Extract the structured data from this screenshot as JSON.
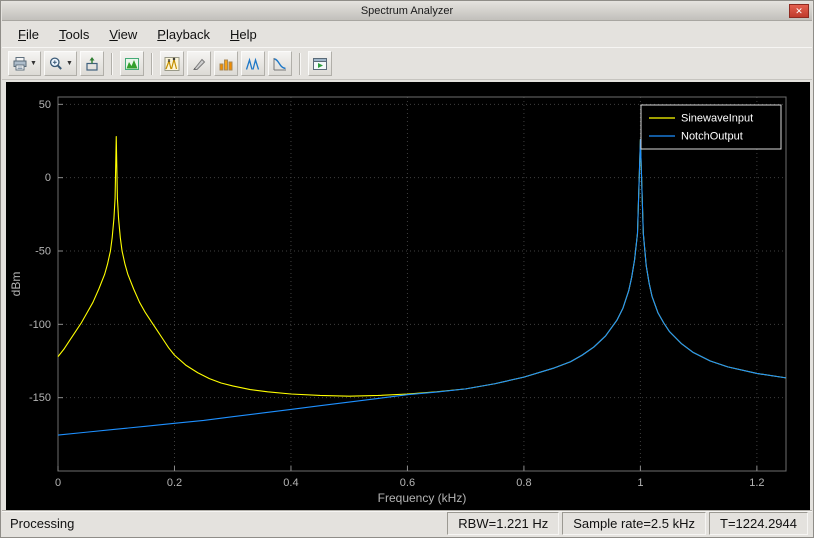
{
  "window": {
    "title": "Spectrum Analyzer"
  },
  "icons": {
    "close": "✕",
    "caret": "▼",
    "toolbar": [
      "printer-icon",
      "zoom-in-icon",
      "scale-axes-icon",
      "spectrum-settings-icon",
      "peak-finder-icon",
      "cursor-measurements-icon",
      "signal-statistics-icon",
      "spectral-mask-icon",
      "ccdf-icon",
      "playback-options-icon"
    ]
  },
  "menubar": {
    "items": [
      "File",
      "Tools",
      "View",
      "Playback",
      "Help"
    ]
  },
  "statusbar": {
    "left": "Processing",
    "panels": [
      "RBW=1.221 Hz",
      "Sample rate=2.5 kHz",
      "T=1224.2944"
    ]
  },
  "chart_data": {
    "type": "line",
    "title": "",
    "xlabel": "Frequency (kHz)",
    "ylabel": "dBm",
    "xlim": [
      0,
      1.25
    ],
    "ylim": [
      -200,
      55
    ],
    "xticks": [
      0,
      0.2,
      0.4,
      0.6,
      0.8,
      1,
      1.2
    ],
    "xtick_labels": [
      "0",
      "0.2",
      "0.4",
      "0.6",
      "0.8",
      "1",
      "1.2"
    ],
    "yticks": [
      50,
      0,
      -50,
      -100,
      -150
    ],
    "ytick_labels": [
      "50",
      "0",
      "-50",
      "-100",
      "-150"
    ],
    "grid": true,
    "background": "#000000",
    "grid_color": "#3f3f3f",
    "axis_color": "#6e6e6e",
    "tick_color": "#b4b4b4",
    "legend_position": "top-right",
    "legend_text_color": "#ffffff",
    "series": [
      {
        "name": "SinewaveInput",
        "color": "#ffff00",
        "points": [
          [
            0,
            -122
          ],
          [
            0.01,
            -117
          ],
          [
            0.02,
            -111
          ],
          [
            0.03,
            -105
          ],
          [
            0.04,
            -99
          ],
          [
            0.05,
            -92
          ],
          [
            0.06,
            -85
          ],
          [
            0.07,
            -76
          ],
          [
            0.08,
            -66
          ],
          [
            0.085,
            -59
          ],
          [
            0.09,
            -50
          ],
          [
            0.093,
            -41
          ],
          [
            0.096,
            -28
          ],
          [
            0.098,
            -14
          ],
          [
            0.1,
            28
          ],
          [
            0.102,
            -14
          ],
          [
            0.104,
            -28
          ],
          [
            0.107,
            -41
          ],
          [
            0.11,
            -50
          ],
          [
            0.115,
            -59
          ],
          [
            0.12,
            -66
          ],
          [
            0.13,
            -76
          ],
          [
            0.14,
            -85
          ],
          [
            0.15,
            -92
          ],
          [
            0.16,
            -98
          ],
          [
            0.17,
            -104
          ],
          [
            0.18,
            -110
          ],
          [
            0.19,
            -116
          ],
          [
            0.2,
            -121
          ],
          [
            0.22,
            -128
          ],
          [
            0.24,
            -133
          ],
          [
            0.26,
            -137
          ],
          [
            0.28,
            -140
          ],
          [
            0.3,
            -142
          ],
          [
            0.33,
            -144.5
          ],
          [
            0.36,
            -146
          ],
          [
            0.4,
            -147.5
          ],
          [
            0.45,
            -148.5
          ],
          [
            0.5,
            -149
          ],
          [
            0.55,
            -148.5
          ],
          [
            0.6,
            -147.5
          ],
          [
            0.65,
            -146
          ],
          [
            0.7,
            -144
          ],
          [
            0.75,
            -140.5
          ],
          [
            0.8,
            -136
          ],
          [
            0.85,
            -130
          ],
          [
            0.88,
            -125.5
          ],
          [
            0.9,
            -121
          ],
          [
            0.92,
            -115.5
          ],
          [
            0.94,
            -108
          ],
          [
            0.96,
            -97
          ],
          [
            0.97,
            -89
          ],
          [
            0.98,
            -77
          ],
          [
            0.985,
            -68
          ],
          [
            0.99,
            -56
          ],
          [
            0.995,
            -38
          ],
          [
            1,
            26
          ],
          [
            1.005,
            -38
          ],
          [
            1.01,
            -60
          ],
          [
            1.015,
            -72
          ],
          [
            1.02,
            -81
          ],
          [
            1.03,
            -92
          ],
          [
            1.04,
            -99
          ],
          [
            1.05,
            -105
          ],
          [
            1.07,
            -113
          ],
          [
            1.09,
            -119
          ],
          [
            1.12,
            -125
          ],
          [
            1.15,
            -129
          ],
          [
            1.2,
            -133.5
          ],
          [
            1.25,
            -136.5
          ]
        ]
      },
      {
        "name": "NotchOutput",
        "color": "#1e90ff",
        "points": [
          [
            0,
            -175.5
          ],
          [
            0.05,
            -173.5
          ],
          [
            0.1,
            -171.5
          ],
          [
            0.15,
            -169.5
          ],
          [
            0.2,
            -167.5
          ],
          [
            0.25,
            -165.5
          ],
          [
            0.3,
            -163
          ],
          [
            0.35,
            -160.5
          ],
          [
            0.4,
            -158
          ],
          [
            0.45,
            -155.5
          ],
          [
            0.5,
            -153
          ],
          [
            0.55,
            -150.5
          ],
          [
            0.6,
            -148
          ],
          [
            0.65,
            -146.2
          ],
          [
            0.7,
            -144
          ],
          [
            0.75,
            -140.5
          ],
          [
            0.8,
            -136
          ],
          [
            0.85,
            -130
          ],
          [
            0.88,
            -125.5
          ],
          [
            0.9,
            -121
          ],
          [
            0.92,
            -115.5
          ],
          [
            0.94,
            -108
          ],
          [
            0.96,
            -97
          ],
          [
            0.97,
            -89
          ],
          [
            0.98,
            -77
          ],
          [
            0.985,
            -68
          ],
          [
            0.99,
            -56
          ],
          [
            0.995,
            -38
          ],
          [
            1,
            26
          ],
          [
            1.005,
            -38
          ],
          [
            1.01,
            -60
          ],
          [
            1.015,
            -72
          ],
          [
            1.02,
            -81
          ],
          [
            1.03,
            -92
          ],
          [
            1.04,
            -99
          ],
          [
            1.05,
            -105
          ],
          [
            1.07,
            -113
          ],
          [
            1.09,
            -119
          ],
          [
            1.12,
            -125
          ],
          [
            1.15,
            -129
          ],
          [
            1.2,
            -133.5
          ],
          [
            1.25,
            -136.5
          ]
        ]
      }
    ]
  }
}
